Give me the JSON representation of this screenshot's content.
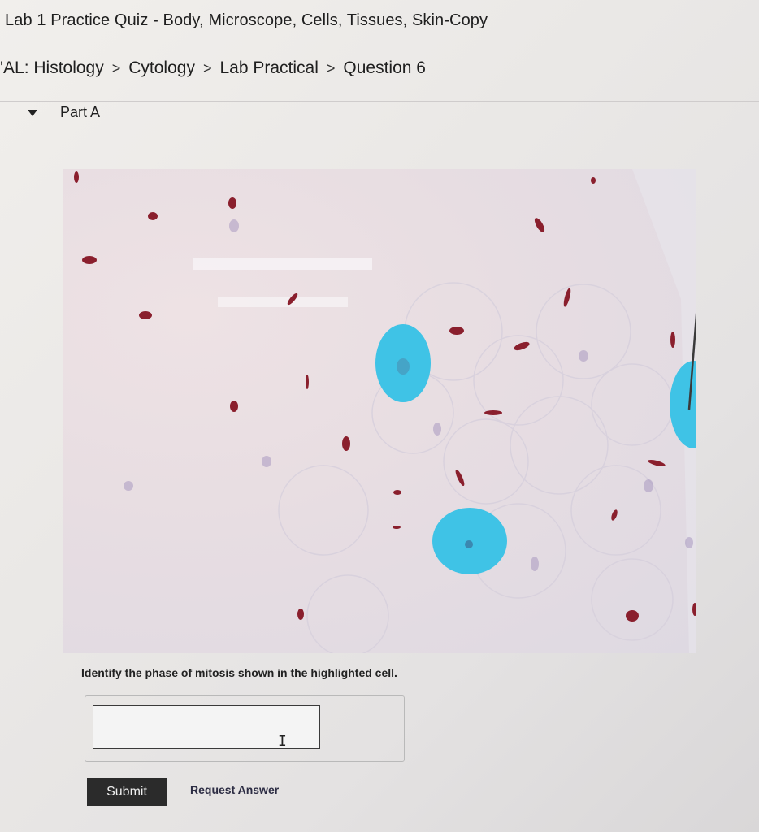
{
  "header": {
    "quiz_title": "Lab 1 Practice Quiz - Body, Microscope, Cells, Tissues, Skin-Copy"
  },
  "breadcrumb": {
    "items": [
      "'AL: Histology",
      "Cytology",
      "Lab Practical",
      "Question 6"
    ],
    "separator": ">"
  },
  "part": {
    "label": "Part A",
    "expanded": true
  },
  "figure": {
    "highlight_color": "#3fc3e6",
    "chromosome_color": "#8a1f2d"
  },
  "question": {
    "prompt": "Identify the phase of mitosis shown in the highlighted cell.",
    "answer_value": "",
    "answer_placeholder": ""
  },
  "actions": {
    "submit_label": "Submit",
    "request_answer_label": "Request Answer"
  },
  "colors": {
    "submit_bg": "#2b2b2b",
    "link": "#2d2d44"
  }
}
